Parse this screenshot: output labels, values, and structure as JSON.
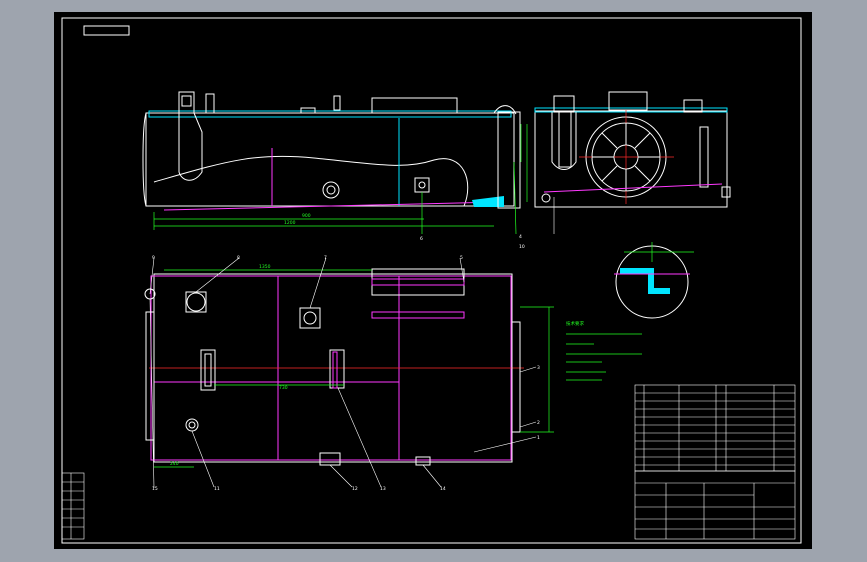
{
  "drawing": {
    "callouts": [
      "1",
      "2",
      "3",
      "4",
      "5",
      "6",
      "7",
      "8",
      "9",
      "10",
      "11",
      "12",
      "13",
      "14",
      "15"
    ],
    "colors": {
      "background": "#000000",
      "frame": "#ffffff",
      "outline": "#ffffff",
      "cover": "#00e5ff",
      "partition": "#ff39ff",
      "dimension": "#22ff22",
      "centerline": "#ff2a2a"
    }
  }
}
